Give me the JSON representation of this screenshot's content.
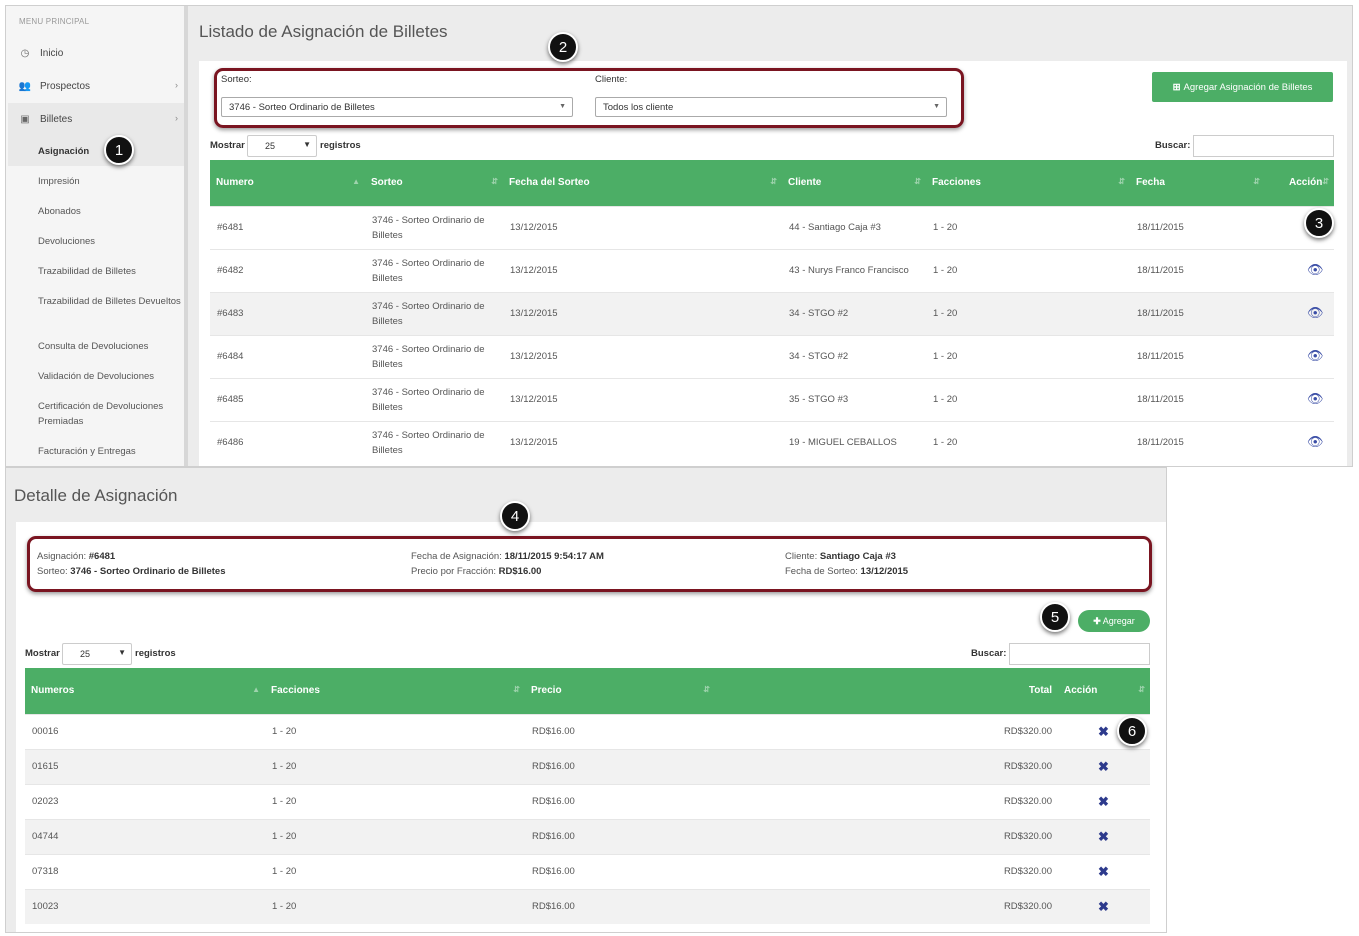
{
  "sidebar": {
    "header": "MENU PRINCIPAL",
    "items": [
      {
        "label": "Inicio",
        "icon": "clock-icon"
      },
      {
        "label": "Prospectos",
        "icon": "users-icon"
      },
      {
        "label": "Billetes",
        "icon": "money-icon"
      }
    ],
    "subitems": [
      "Asignación",
      "Impresión",
      "Abonados",
      "Devoluciones",
      "Trazabilidad de Billetes",
      "Trazabilidad de Billetes Devueltos",
      "Consulta de Devoluciones",
      "Validación de Devoluciones",
      "Certificación de Devoluciones Premiadas",
      "Facturación y Entregas"
    ]
  },
  "listado": {
    "title": "Listado de Asignación de Billetes",
    "sorteo_label": "Sorteo:",
    "sorteo_value": "3746 - Sorteo Ordinario de Billetes",
    "cliente_label": "Cliente:",
    "cliente_value": "Todos los cliente",
    "add_button": "Agregar Asignación de Billetes",
    "mostrar": "Mostrar",
    "page_len": "25",
    "registros": "registros",
    "buscar": "Buscar:",
    "columns": [
      "Numero",
      "Sorteo",
      "Fecha del Sorteo",
      "Cliente",
      "Facciones",
      "Fecha",
      "Acción"
    ],
    "rows": [
      {
        "numero": "#6481",
        "sorteo": "3746 - Sorteo Ordinario de Billetes",
        "fecha_sorteo": "13/12/2015",
        "cliente": "44 - Santiago Caja #3",
        "facciones": "1 - 20",
        "fecha": "18/11/2015"
      },
      {
        "numero": "#6482",
        "sorteo": "3746 - Sorteo Ordinario de Billetes",
        "fecha_sorteo": "13/12/2015",
        "cliente": "43 - Nurys Franco Francisco",
        "facciones": "1 - 20",
        "fecha": "18/11/2015"
      },
      {
        "numero": "#6483",
        "sorteo": "3746 - Sorteo Ordinario de Billetes",
        "fecha_sorteo": "13/12/2015",
        "cliente": "34 - STGO #2",
        "facciones": "1 - 20",
        "fecha": "18/11/2015"
      },
      {
        "numero": "#6484",
        "sorteo": "3746 - Sorteo Ordinario de Billetes",
        "fecha_sorteo": "13/12/2015",
        "cliente": "34 - STGO #2",
        "facciones": "1 - 20",
        "fecha": "18/11/2015"
      },
      {
        "numero": "#6485",
        "sorteo": "3746 - Sorteo Ordinario de Billetes",
        "fecha_sorteo": "13/12/2015",
        "cliente": "35 - STGO #3",
        "facciones": "1 - 20",
        "fecha": "18/11/2015"
      },
      {
        "numero": "#6486",
        "sorteo": "3746 - Sorteo Ordinario de Billetes",
        "fecha_sorteo": "13/12/2015",
        "cliente": "19 - MIGUEL CEBALLOS",
        "facciones": "1 - 20",
        "fecha": "18/11/2015"
      }
    ]
  },
  "detalle": {
    "title": "Detalle de Asignación",
    "asignacion_label": "Asignación:",
    "asignacion_value": "#6481",
    "sorteo_label": "Sorteo:",
    "sorteo_value": "3746 - Sorteo Ordinario de Billetes",
    "fecha_asig_label": "Fecha de Asignación:",
    "fecha_asig_value": "18/11/2015 9:54:17 AM",
    "precio_label": "Precio por Fracción:",
    "precio_value": "RD$16.00",
    "cliente_label": "Cliente:",
    "cliente_value": "Santiago Caja #3",
    "fecha_sorteo_label": "Fecha de Sorteo:",
    "fecha_sorteo_value": "13/12/2015",
    "add_button": "Agregar",
    "mostrar": "Mostrar",
    "page_len": "25",
    "registros": "registros",
    "buscar": "Buscar:",
    "columns": [
      "Numeros",
      "Facciones",
      "Precio",
      "Total",
      "Acción"
    ],
    "rows": [
      {
        "numero": "00016",
        "facciones": "1 - 20",
        "precio": "RD$16.00",
        "total": "RD$320.00"
      },
      {
        "numero": "01615",
        "facciones": "1 - 20",
        "precio": "RD$16.00",
        "total": "RD$320.00"
      },
      {
        "numero": "02023",
        "facciones": "1 - 20",
        "precio": "RD$16.00",
        "total": "RD$320.00"
      },
      {
        "numero": "04744",
        "facciones": "1 - 20",
        "precio": "RD$16.00",
        "total": "RD$320.00"
      },
      {
        "numero": "07318",
        "facciones": "1 - 20",
        "precio": "RD$16.00",
        "total": "RD$320.00"
      },
      {
        "numero": "10023",
        "facciones": "1 - 20",
        "precio": "RD$16.00",
        "total": "RD$320.00"
      }
    ]
  },
  "callouts": [
    "1",
    "2",
    "3",
    "4",
    "5",
    "6"
  ],
  "colors": {
    "green": "#4cae66",
    "callout_border": "#7a1521",
    "icon_blue": "#3b4ea6"
  }
}
